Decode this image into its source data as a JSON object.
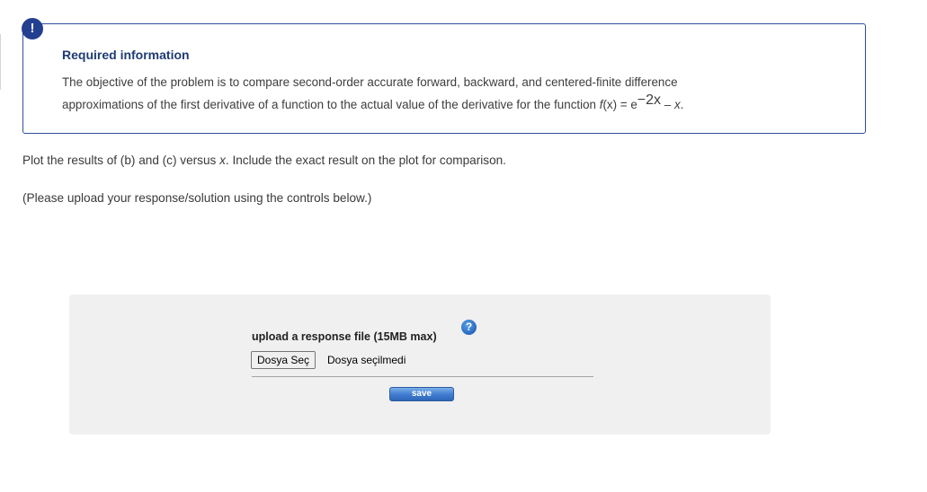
{
  "alert": {
    "symbol": "!"
  },
  "info": {
    "title": "Required information",
    "body_line1": "The objective of the problem is to compare second-order accurate forward, backward, and centered-finite difference",
    "body_line2_text": "approximations of the first derivative of a function to the actual value of the derivative for the function ",
    "formula_fx": "f",
    "formula_x_paren": "(x)",
    "formula_eq": " = e",
    "formula_exp": "−2x",
    "formula_tail": " – ",
    "formula_x": "x",
    "formula_end": "."
  },
  "prompt": {
    "text_before": "Plot the results of (b) and (c) versus ",
    "x": "x",
    "text_after": ". Include the exact result on the plot for comparison."
  },
  "instruction": "(Please upload your response/solution using the controls below.)",
  "upload": {
    "label": "upload a response file (15MB max)",
    "help_symbol": "?",
    "file_button": "Dosya Seç",
    "file_status": "Dosya seçilmedi",
    "save_label": "save"
  },
  "colors": {
    "accent": "#233f8f",
    "title": "#1f3b73",
    "panel": "#f0f0f0",
    "save": "#3f7bd0"
  }
}
